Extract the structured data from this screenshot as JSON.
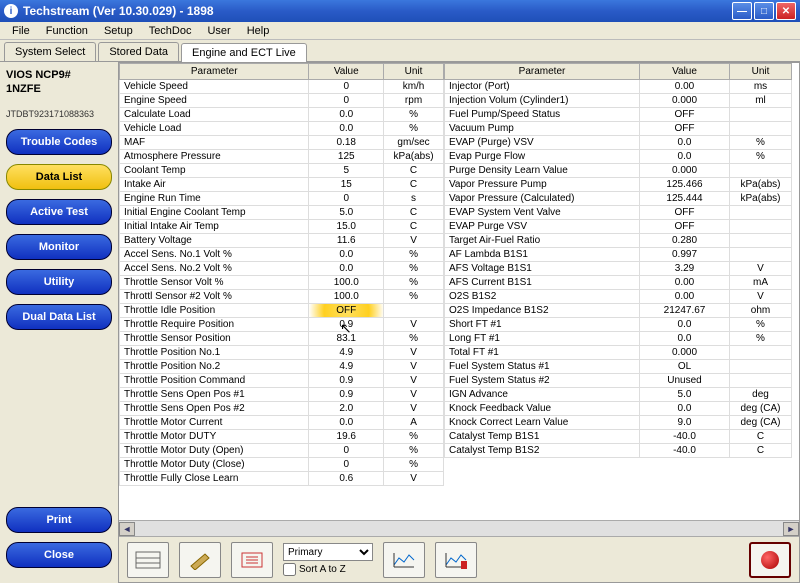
{
  "title": "Techstream (Ver 10.30.029) - 1898",
  "menu": [
    "File",
    "Function",
    "Setup",
    "TechDoc",
    "User",
    "Help"
  ],
  "tabs": [
    {
      "label": "System Select",
      "active": false
    },
    {
      "label": "Stored Data",
      "active": false
    },
    {
      "label": "Engine and ECT Live",
      "active": true
    }
  ],
  "vehicle": {
    "model": "VIOS NCP9#",
    "engine": "1NZFE",
    "vin": "JTDBT923171088363"
  },
  "sidebar": [
    {
      "label": "Trouble Codes",
      "yellow": false
    },
    {
      "label": "Data List",
      "yellow": true
    },
    {
      "label": "Active Test",
      "yellow": false
    },
    {
      "label": "Monitor",
      "yellow": false
    },
    {
      "label": "Utility",
      "yellow": false
    },
    {
      "label": "Dual Data List",
      "yellow": false
    }
  ],
  "bottom_buttons": [
    {
      "label": "Print"
    },
    {
      "label": "Close"
    }
  ],
  "headers": {
    "param": "Parameter",
    "value": "Value",
    "unit": "Unit"
  },
  "left_rows": [
    {
      "p": "Vehicle Speed",
      "v": "0",
      "u": "km/h"
    },
    {
      "p": "Engine Speed",
      "v": "0",
      "u": "rpm"
    },
    {
      "p": "Calculate Load",
      "v": "0.0",
      "u": "%"
    },
    {
      "p": "Vehicle Load",
      "v": "0.0",
      "u": "%"
    },
    {
      "p": "MAF",
      "v": "0.18",
      "u": "gm/sec"
    },
    {
      "p": "Atmosphere Pressure",
      "v": "125",
      "u": "kPa(abs)"
    },
    {
      "p": "Coolant Temp",
      "v": "5",
      "u": "C"
    },
    {
      "p": "Intake Air",
      "v": "15",
      "u": "C"
    },
    {
      "p": "Engine Run Time",
      "v": "0",
      "u": "s"
    },
    {
      "p": "Initial Engine Coolant Temp",
      "v": "5.0",
      "u": "C"
    },
    {
      "p": "Initial Intake Air Temp",
      "v": "15.0",
      "u": "C"
    },
    {
      "p": "Battery Voltage",
      "v": "11.6",
      "u": "V"
    },
    {
      "p": "Accel Sens. No.1 Volt %",
      "v": "0.0",
      "u": "%"
    },
    {
      "p": "Accel Sens. No.2 Volt %",
      "v": "0.0",
      "u": "%"
    },
    {
      "p": "Throttle Sensor Volt %",
      "v": "100.0",
      "u": "%"
    },
    {
      "p": "Throttl Sensor #2 Volt %",
      "v": "100.0",
      "u": "%"
    },
    {
      "p": "Throttle Idle Position",
      "v": "OFF",
      "u": "",
      "highlight": true
    },
    {
      "p": "Throttle Require Position",
      "v": "0.9",
      "u": "V"
    },
    {
      "p": "Throttle Sensor Position",
      "v": "83.1",
      "u": "%"
    },
    {
      "p": "Throttle Position No.1",
      "v": "4.9",
      "u": "V"
    },
    {
      "p": "Throttle Position No.2",
      "v": "4.9",
      "u": "V"
    },
    {
      "p": "Throttle Position Command",
      "v": "0.9",
      "u": "V"
    },
    {
      "p": "Throttle Sens Open Pos #1",
      "v": "0.9",
      "u": "V"
    },
    {
      "p": "Throttle Sens Open Pos #2",
      "v": "2.0",
      "u": "V"
    },
    {
      "p": "Throttle Motor Current",
      "v": "0.0",
      "u": "A"
    },
    {
      "p": "Throttle Motor DUTY",
      "v": "19.6",
      "u": "%"
    },
    {
      "p": "Throttle Motor Duty (Open)",
      "v": "0",
      "u": "%"
    },
    {
      "p": "Throttle Motor Duty (Close)",
      "v": "0",
      "u": "%"
    },
    {
      "p": "Throttle Fully Close Learn",
      "v": "0.6",
      "u": "V"
    }
  ],
  "right_rows": [
    {
      "p": "Injector (Port)",
      "v": "0.00",
      "u": "ms"
    },
    {
      "p": "Injection Volum (Cylinder1)",
      "v": "0.000",
      "u": "ml"
    },
    {
      "p": "Fuel Pump/Speed Status",
      "v": "OFF",
      "u": ""
    },
    {
      "p": "Vacuum Pump",
      "v": "OFF",
      "u": ""
    },
    {
      "p": "EVAP (Purge) VSV",
      "v": "0.0",
      "u": "%"
    },
    {
      "p": "Evap Purge Flow",
      "v": "0.0",
      "u": "%"
    },
    {
      "p": "Purge Density Learn Value",
      "v": "0.000",
      "u": ""
    },
    {
      "p": "Vapor Pressure Pump",
      "v": "125.466",
      "u": "kPa(abs)"
    },
    {
      "p": "Vapor Pressure (Calculated)",
      "v": "125.444",
      "u": "kPa(abs)"
    },
    {
      "p": "EVAP System Vent Valve",
      "v": "OFF",
      "u": ""
    },
    {
      "p": "EVAP Purge VSV",
      "v": "OFF",
      "u": ""
    },
    {
      "p": "Target Air-Fuel Ratio",
      "v": "0.280",
      "u": ""
    },
    {
      "p": "AF Lambda B1S1",
      "v": "0.997",
      "u": ""
    },
    {
      "p": "AFS Voltage B1S1",
      "v": "3.29",
      "u": "V"
    },
    {
      "p": "AFS Current B1S1",
      "v": "0.00",
      "u": "mA"
    },
    {
      "p": "O2S B1S2",
      "v": "0.00",
      "u": "V"
    },
    {
      "p": "O2S Impedance B1S2",
      "v": "21247.67",
      "u": "ohm"
    },
    {
      "p": "Short FT #1",
      "v": "0.0",
      "u": "%"
    },
    {
      "p": "Long FT #1",
      "v": "0.0",
      "u": "%"
    },
    {
      "p": "Total FT #1",
      "v": "0.000",
      "u": ""
    },
    {
      "p": "Fuel System Status #1",
      "v": "OL",
      "u": ""
    },
    {
      "p": "Fuel System Status #2",
      "v": "Unused",
      "u": ""
    },
    {
      "p": "IGN Advance",
      "v": "5.0",
      "u": "deg"
    },
    {
      "p": "Knock Feedback Value",
      "v": "0.0",
      "u": "deg (CA)"
    },
    {
      "p": "Knock Correct Learn Value",
      "v": "9.0",
      "u": "deg (CA)"
    },
    {
      "p": "Catalyst Temp B1S1",
      "v": "-40.0",
      "u": "C"
    },
    {
      "p": "Catalyst Temp B1S2",
      "v": "-40.0",
      "u": "C"
    }
  ],
  "toolbar": {
    "select": "Primary",
    "sort_label": "Sort A to Z"
  }
}
